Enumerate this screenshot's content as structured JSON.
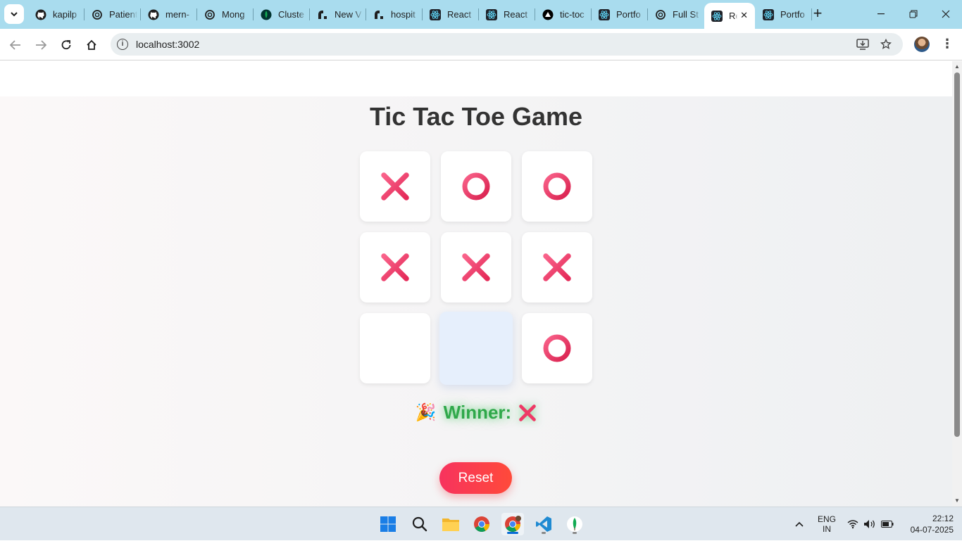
{
  "browser": {
    "tabs": [
      {
        "label": "kapilp",
        "icon": "github-icon"
      },
      {
        "label": "Patient",
        "icon": "openai-icon"
      },
      {
        "label": "mern-",
        "icon": "github-icon"
      },
      {
        "label": "Mong",
        "icon": "openai-icon"
      },
      {
        "label": "Cluste",
        "icon": "mongodb-icon"
      },
      {
        "label": "New V",
        "icon": "render-icon"
      },
      {
        "label": "hospit",
        "icon": "render-icon"
      },
      {
        "label": "React",
        "icon": "react-icon"
      },
      {
        "label": "React",
        "icon": "react-icon"
      },
      {
        "label": "tic-toc",
        "icon": "vercel-icon"
      },
      {
        "label": "Portfo",
        "icon": "react-icon"
      },
      {
        "label": "Full St",
        "icon": "openai-icon"
      },
      {
        "label": "Re",
        "icon": "react-icon",
        "active": true
      },
      {
        "label": "Portfo",
        "icon": "react-icon"
      }
    ],
    "url": "localhost:3002"
  },
  "game": {
    "title": "Tic Tac Toe Game",
    "board": [
      "X",
      "O",
      "O",
      "X",
      "X",
      "X",
      "",
      "",
      "O"
    ],
    "hovered_cell": 7,
    "winner_emoji": "🎉",
    "winner_label": "Winner:",
    "winner_symbol": "X",
    "reset_label": "Reset",
    "colors": {
      "mark": "#ee3a66",
      "winner_text": "#2fa84a",
      "reset_start": "#f7335e",
      "reset_end": "#ff4a3a"
    }
  },
  "taskbar": {
    "apps": [
      "windows-start-icon",
      "search-icon",
      "file-explorer-icon",
      "chrome-icon",
      "chrome-profile-icon",
      "vscode-icon",
      "mongodb-compass-icon"
    ],
    "language_line1": "ENG",
    "language_line2": "IN",
    "time": "22:12",
    "date": "04-07-2025"
  }
}
